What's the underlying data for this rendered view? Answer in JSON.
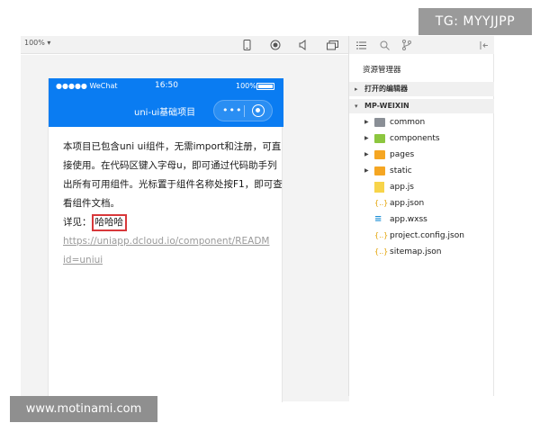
{
  "watermark_top": "TG: MYYJJPP",
  "watermark_bottom": "www.motinami.com",
  "simulator": {
    "zoom": "100% ▾",
    "toolbar_icons": [
      "phone-icon",
      "record-icon",
      "audio-icon",
      "window-icon"
    ]
  },
  "phone": {
    "carrier": "●●●●● WeChat",
    "time": "16:50",
    "battery": "100%",
    "nav_title": "uni-ui基础项目",
    "capsule_more": "•••",
    "content": {
      "paragraph": "本项目已包含uni ui组件，无需import和注册，可直接使用。在代码区键入字母u，即可通过代码助手列出所有可用组件。光标置于组件名称处按F1，即可查看组件文档。",
      "see_label": "详见：",
      "highlight": "哈哈哈",
      "link_line1": "https://uniapp.dcloud.io/component/READM",
      "link_line2": "id=uniui"
    }
  },
  "explorer": {
    "title": "资源管理器",
    "open_editors": "打开的编辑器",
    "project": "MP-WEIXIN",
    "items": [
      {
        "name": "common",
        "type": "folder-grey",
        "caret": true
      },
      {
        "name": "components",
        "type": "folder-green",
        "caret": true
      },
      {
        "name": "pages",
        "type": "folder-orange",
        "caret": true
      },
      {
        "name": "static",
        "type": "folder-orange",
        "caret": true
      },
      {
        "name": "app.js",
        "type": "js",
        "caret": false
      },
      {
        "name": "app.json",
        "type": "json",
        "caret": false
      },
      {
        "name": "app.wxss",
        "type": "css",
        "caret": false
      },
      {
        "name": "project.config.json",
        "type": "json",
        "caret": false
      },
      {
        "name": "sitemap.json",
        "type": "json",
        "caret": false
      }
    ]
  },
  "colors": {
    "accent": "#0a7cf2",
    "highlight_border": "#d8383a"
  }
}
